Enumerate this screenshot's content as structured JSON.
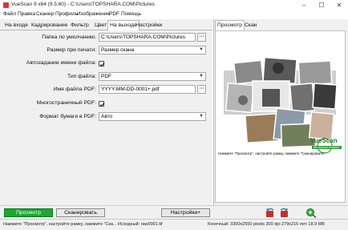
{
  "window": {
    "title": "VueScan 9 x64 (9.5.60) - C:\\Users\\TOPSHARA.COM\\Pictures"
  },
  "menu": [
    "Файл",
    "Правка",
    "Сканер",
    "Профиль",
    "Изображение",
    "PDF",
    "Помощь"
  ],
  "tabs": [
    "На входе",
    "Кадрирование",
    "Фильтр",
    "Цвет",
    "На выходе",
    "Настройки"
  ],
  "active_tab": "На выходе",
  "right_tabs": [
    "Просмотр",
    "Скан"
  ],
  "form": {
    "folder_label": "Папка по умолчанию:",
    "folder_value": "C:\\Users\\TOPSHARA.COM\\Pictures",
    "print_size_label": "Размер при печати:",
    "print_size_value": "Размер скана",
    "autoname_label": "Автозадание имени файла:",
    "filetype_label": "Тип файла:",
    "filetype_value": "PDF",
    "pdfname_label": "Имя файла PDF:",
    "pdfname_value": "YYYY-MM-DD-0001+.pdf",
    "multipage_label": "Многостраничный PDF:",
    "paper_label": "Формат бумаги в PDF:",
    "paper_value": "Авто"
  },
  "preview": {
    "caption": "Нажмите \"Просмотр\", настройте рамку, нажмите \"Сканировать\".",
    "logo_text": "VueScan",
    "logo_tagline": "the scanner software"
  },
  "buttons": {
    "preview": "Просмотр",
    "scan": "Сканировать",
    "settings": "Настройки+"
  },
  "status": {
    "left": "Нажмите \"Просмотр\", настройте рамку, нажмите \"Ска...",
    "middle": "Исходный: raw0001.tif",
    "right": "Конечный: 3300x2550 pixels 300 dpi 279x216 mm 18.9 MB"
  },
  "colors": {
    "accent_green": "#19a830"
  }
}
